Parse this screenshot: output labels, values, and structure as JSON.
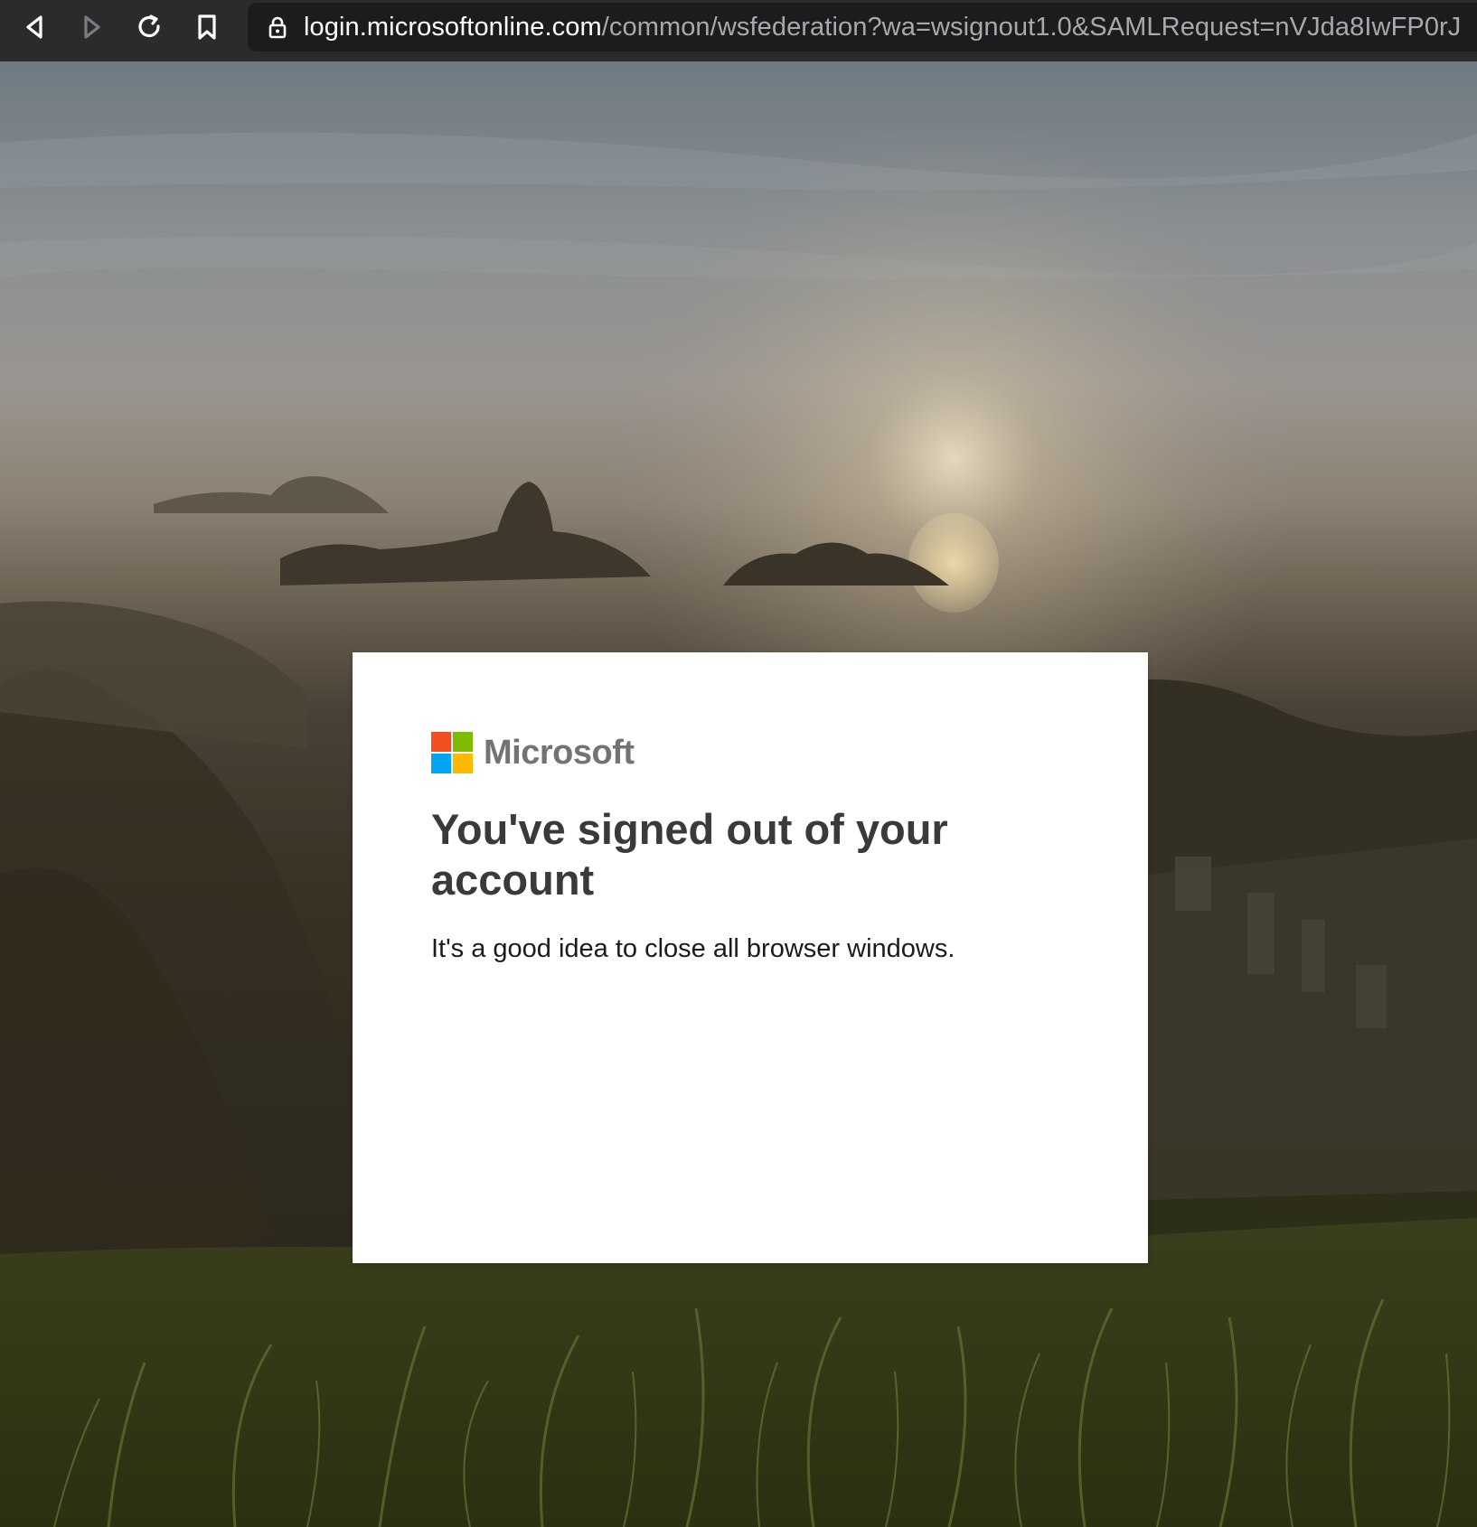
{
  "browser": {
    "url_host": "login.microsoftonline.com",
    "url_path": "/common/wsfederation?wa=wsignout1.0&SAMLRequest=nVJda8IwFP0rJ",
    "icons": {
      "back": "back-arrow-icon",
      "forward": "forward-arrow-icon",
      "reload": "reload-icon",
      "bookmark": "bookmark-icon",
      "lock": "lock-icon"
    }
  },
  "card": {
    "brand_name": "Microsoft",
    "title": "You've signed out of your account",
    "message": "It's a good idea to close all browser windows.",
    "logo_colors": [
      "#f25022",
      "#7fba00",
      "#00a4ef",
      "#ffb900"
    ]
  }
}
